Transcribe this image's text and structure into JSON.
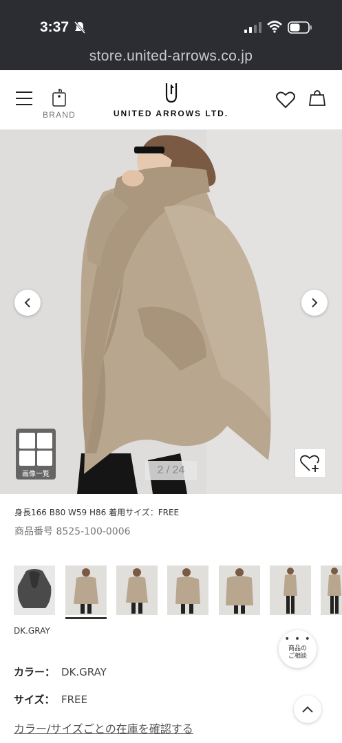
{
  "status_bar": {
    "time": "3:37",
    "url": "store.united-arrows.co.jp"
  },
  "header": {
    "brand_label": "BRAND",
    "logo_text": "UNITED ARROWS LTD."
  },
  "gallery": {
    "grid_label": "画像一覧",
    "page_indicator": "2 / 24"
  },
  "product": {
    "model_info": "身長166 B80 W59 H86 着用サイズ：FREE",
    "product_code": "商品番号 8525-100-0006",
    "color_caption": "DK.GRAY",
    "consult_label_1": "商品の",
    "consult_label_2": "ご相談",
    "color_key": "カラー：",
    "color_value": "DK.GRAY",
    "size_key": "サイズ：",
    "size_value": "FREE",
    "stock_link": "カラー/サイズごとの在庫を確認する"
  },
  "colors": {
    "status_bg": "#2b2d33",
    "coat": "#b5a28a",
    "hero_bg": "#dcdcda"
  }
}
